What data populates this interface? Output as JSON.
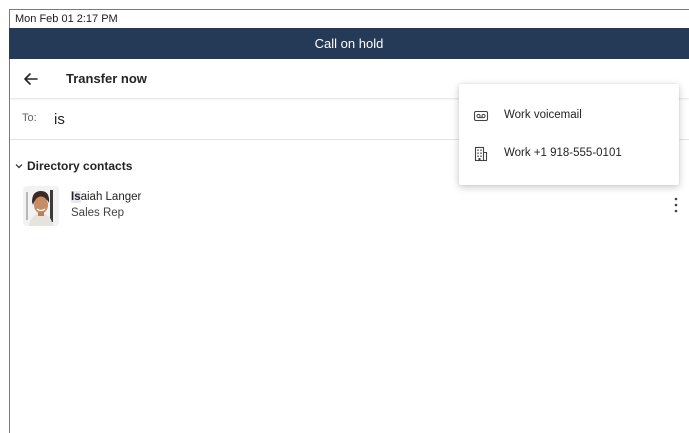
{
  "status_bar": {
    "datetime": "Mon Feb 01  2:17 PM"
  },
  "title_bar": {
    "title": "Call on hold"
  },
  "header": {
    "back_icon": "arrow-left-icon",
    "title": "Transfer now"
  },
  "to_field": {
    "label": "To:",
    "value": "is",
    "placeholder": ""
  },
  "directory": {
    "section_title": "Directory contacts",
    "contacts": [
      {
        "name_highlight": "Is",
        "name_rest": "aiah Langer",
        "role": "Sales Rep"
      }
    ]
  },
  "context_menu": {
    "items": [
      {
        "icon": "voicemail-icon",
        "label": "Work voicemail"
      },
      {
        "icon": "building-icon",
        "label": "Work +1 918-555-0101"
      }
    ]
  },
  "colors": {
    "titlebar_bg": "#243a56",
    "titlebar_text": "#ffffff",
    "text": "#242424"
  }
}
